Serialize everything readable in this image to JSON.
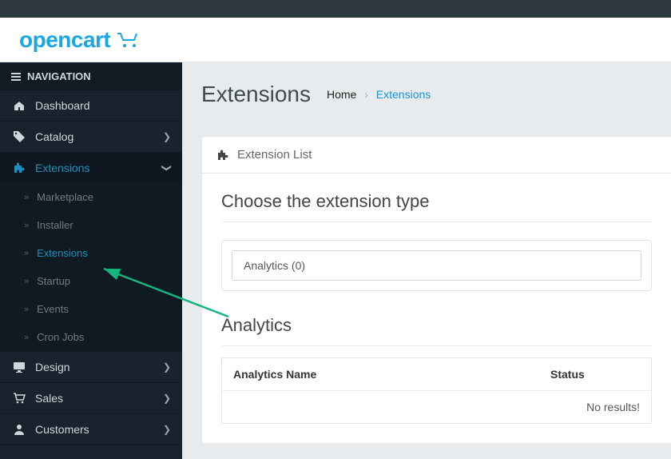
{
  "brand": "opencart",
  "sidebar": {
    "title": "NAVIGATION",
    "items": {
      "dashboard": "Dashboard",
      "catalog": "Catalog",
      "extensions": "Extensions",
      "design": "Design",
      "sales": "Sales",
      "customers": "Customers"
    },
    "extensions_submenu": {
      "marketplace": "Marketplace",
      "installer": "Installer",
      "extensions": "Extensions",
      "startup": "Startup",
      "events": "Events",
      "cronjobs": "Cron Jobs"
    }
  },
  "page": {
    "title": "Extensions",
    "breadcrumb": {
      "home": "Home",
      "current": "Extensions"
    }
  },
  "panel": {
    "heading": "Extension List",
    "choose": "Choose the extension type",
    "select_value": "Analytics (0)",
    "section_title": "Analytics",
    "columns": {
      "name": "Analytics Name",
      "status": "Status"
    },
    "no_results": "No results!"
  }
}
